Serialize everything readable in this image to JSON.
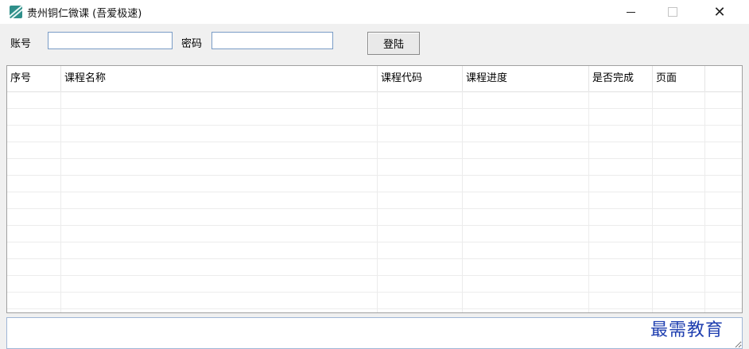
{
  "window": {
    "title": "贵州铜仁微课 (吾爱极速)",
    "icon": "app-logo-icon",
    "controls": [
      "minimize-icon",
      "maximize-icon",
      "close-icon"
    ],
    "close_glyph": "✕"
  },
  "login": {
    "account_label": "账号",
    "account_value": "",
    "password_label": "密码",
    "password_value": "",
    "login_button": "登陆"
  },
  "table": {
    "columns": [
      "序号",
      "课程名称",
      "课程代码",
      "课程进度",
      "是否完成",
      "页面"
    ],
    "rows": []
  },
  "output": {
    "text": ""
  },
  "watermark": "最需教育",
  "colors": {
    "accent_border": "#7a9cc6",
    "watermark": "#1f3fb0"
  }
}
